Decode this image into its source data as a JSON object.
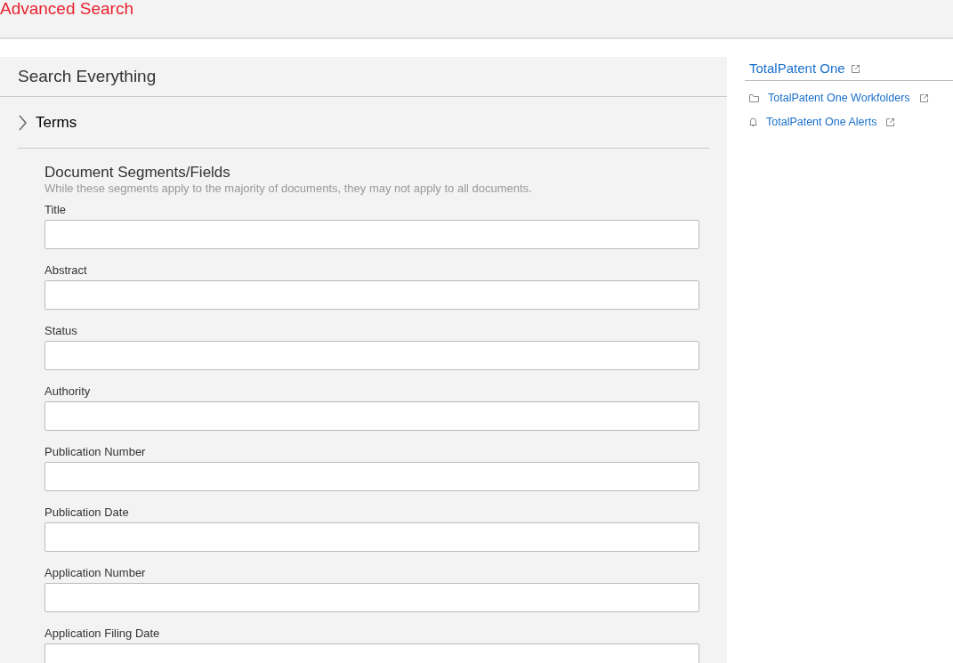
{
  "header": {
    "title": "Advanced Search"
  },
  "panel": {
    "title": "Search Everything",
    "terms": {
      "label": "Terms",
      "expanded": false
    },
    "segments": {
      "title": "Document Segments/Fields",
      "note": "While these segments apply to the majority of documents, they may not apply to all documents.",
      "fields": [
        {
          "label": "Title"
        },
        {
          "label": "Abstract"
        },
        {
          "label": "Status"
        },
        {
          "label": "Authority"
        },
        {
          "label": "Publication Number"
        },
        {
          "label": "Publication Date"
        },
        {
          "label": "Application Number"
        },
        {
          "label": "Application Filing Date"
        }
      ]
    }
  },
  "sidebar": {
    "title": "TotalPatent One",
    "links": [
      {
        "kind": "folder",
        "label": "TotalPatent One Workfolders"
      },
      {
        "kind": "bell",
        "label": "TotalPatent One Alerts"
      }
    ]
  }
}
